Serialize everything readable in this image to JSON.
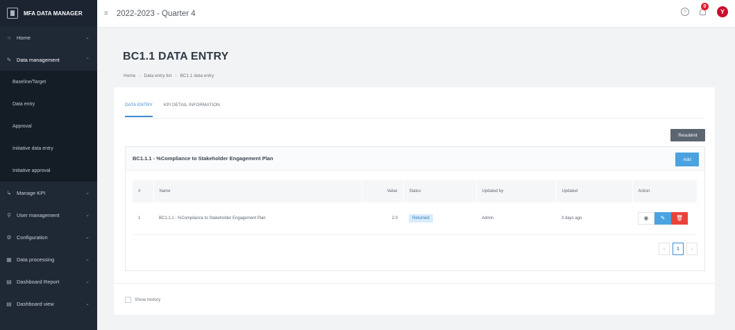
{
  "app": {
    "brand": "MFA DATA MANAGER"
  },
  "header": {
    "period": "2022-2023 - Quarter 4",
    "notification_count": "0",
    "avatar_initial": "Y"
  },
  "sidebar": {
    "items": [
      {
        "label": "Home",
        "icon": "home-icon"
      },
      {
        "label": "Data management",
        "icon": "edit-icon"
      },
      {
        "label": "Manage KPI",
        "icon": "kpi-icon"
      },
      {
        "label": "User management",
        "icon": "user-icon"
      },
      {
        "label": "Configuration",
        "icon": "gear-icon"
      },
      {
        "label": "Data processing",
        "icon": "grid-icon"
      },
      {
        "label": "Dashboard Report",
        "icon": "report-icon"
      },
      {
        "label": "Dashboard view",
        "icon": "dashboard-icon"
      }
    ],
    "submenu": [
      "Baseline/Target",
      "Data entry",
      "Approval",
      "Initiative data entry",
      "Initiative approval"
    ]
  },
  "page": {
    "title": "BC1.1 DATA ENTRY",
    "breadcrumb": [
      "Home",
      "Data entry list",
      "BC1.1 data entry"
    ],
    "tabs": [
      "DATA ENTRY",
      "KPI DETAIL INFORMATION"
    ],
    "resubmit_label": "Resubmit",
    "panel_title": "BC1.1.1 - %Compliance to Stakeholder Engagement Plan",
    "add_label": "Add",
    "table": {
      "headers": [
        "#",
        "Name",
        "Value",
        "Status",
        "Updated by",
        "Updated",
        "Action"
      ],
      "rows": [
        {
          "index": "1",
          "name": "BC1.1.1 - %Compliance to Stakeholder Engagement Plan",
          "value": "2.0",
          "status": "Returned",
          "updated_by": "Admin",
          "updated": "3 days ago"
        }
      ]
    },
    "pagination": {
      "prev": "‹",
      "current": "1",
      "next": "›"
    },
    "show_history_label": "Show history"
  },
  "colors": {
    "sidebar_bg": "#1f2936",
    "accent": "#3a8ad6",
    "danger": "#e8433a",
    "avatar": "#c8102e"
  }
}
